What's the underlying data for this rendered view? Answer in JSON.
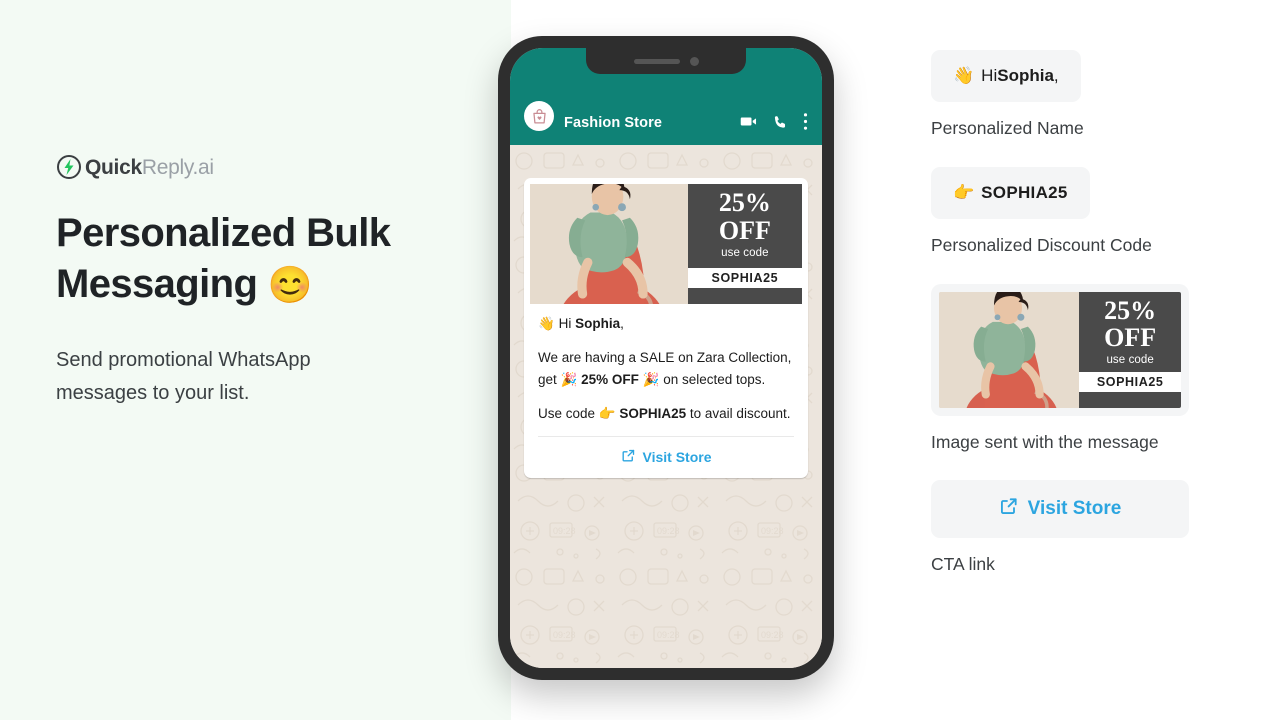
{
  "brand": {
    "logo_bold": "Quick",
    "logo_light": "Reply.ai",
    "logo_icon": "lightning-bolt-circle-icon",
    "accent_green": "#22c55e"
  },
  "hero": {
    "headline_line1": "Personalized Bulk",
    "headline_line2": "Messaging",
    "headline_emoji": "😊",
    "subhead": "Send promotional WhatsApp messages to your list."
  },
  "phone": {
    "whatsapp": {
      "contact_name": "Fashion Store",
      "avatar_icon": "shopping-bag-heart-icon",
      "header_color": "#0f8276",
      "icons": [
        "video-call-icon",
        "voice-call-icon",
        "more-options-icon"
      ]
    },
    "message": {
      "greeting_emoji": "👋",
      "greeting_text": "Hi ",
      "greeting_name": "Sophia",
      "greeting_comma": ",",
      "body_part1": "We are having a SALE on Zara Collection, get ",
      "body_emoji1": "🎉",
      "body_bold": "25% OFF",
      "body_emoji2": "🎉",
      "body_part2": " on selected tops.",
      "body2_part1": "Use code ",
      "body2_emoji": "👉",
      "body2_code": "SOPHIA25",
      "body2_part2": " to avail discount.",
      "cta_label": "Visit Store",
      "cta_icon": "external-link-icon",
      "cta_color": "#2ca5e0"
    },
    "promo_image": {
      "discount": "25%",
      "off_label": "OFF",
      "use_code_label": "use code",
      "code": "SOPHIA25",
      "panel_color": "#4a4a4a",
      "model_alt": "woman-in-green-top-and-coral-skirt"
    }
  },
  "annotations": [
    {
      "card_emoji": "👋",
      "card_text": "Hi ",
      "card_bold": "Sophia",
      "card_suffix": ",",
      "label": "Personalized Name"
    },
    {
      "card_emoji": "👉",
      "card_bold": "SOPHIA25",
      "label": "Personalized Discount Code"
    },
    {
      "label": "Image sent with the message"
    },
    {
      "cta_label": "Visit Store",
      "cta_icon": "external-link-icon",
      "label": "CTA link"
    }
  ]
}
